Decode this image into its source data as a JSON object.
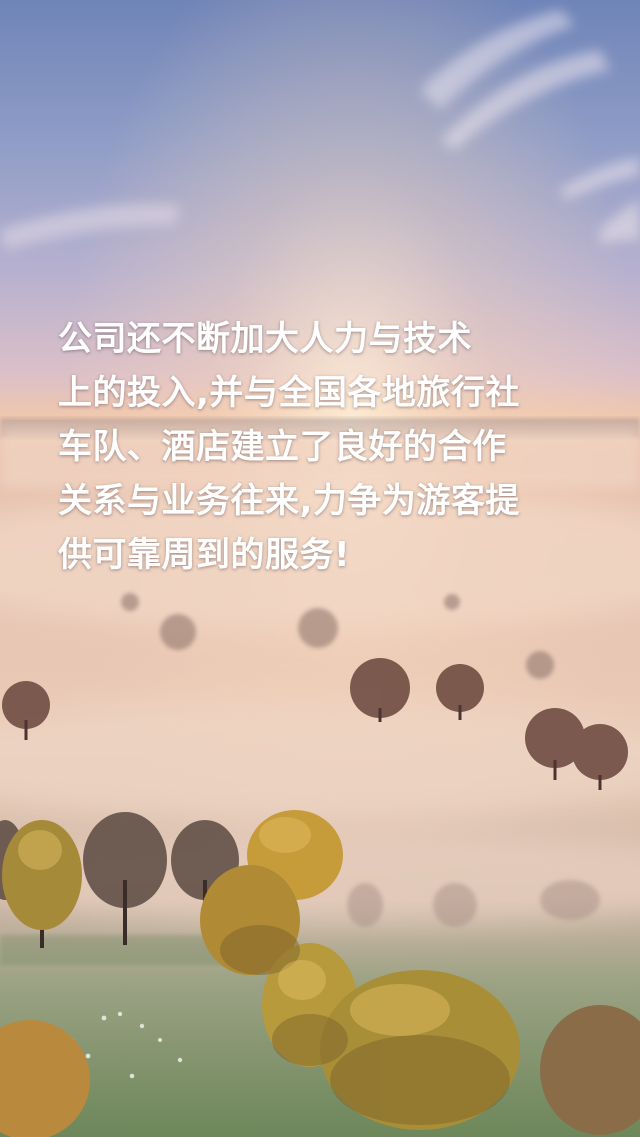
{
  "caption": {
    "lines": [
      "公司还不断加大人力与技术",
      "上的投入,并与全国各地旅行社",
      "车队、酒店建立了良好的合作",
      "关系与业务往来,力争为游客提",
      "供可靠周到的服务!"
    ]
  },
  "scene": {
    "subject": "misty-countryside-sunrise",
    "colors": {
      "sky_top": "#7d8fbe",
      "sky_mid": "#c9b6cc",
      "horizon": "#f1c7a6",
      "mist": "#ead0bf",
      "foliage_gold": "#c79a3a",
      "foliage_dark": "#5b4436",
      "meadow": "#7e9a6a"
    }
  }
}
